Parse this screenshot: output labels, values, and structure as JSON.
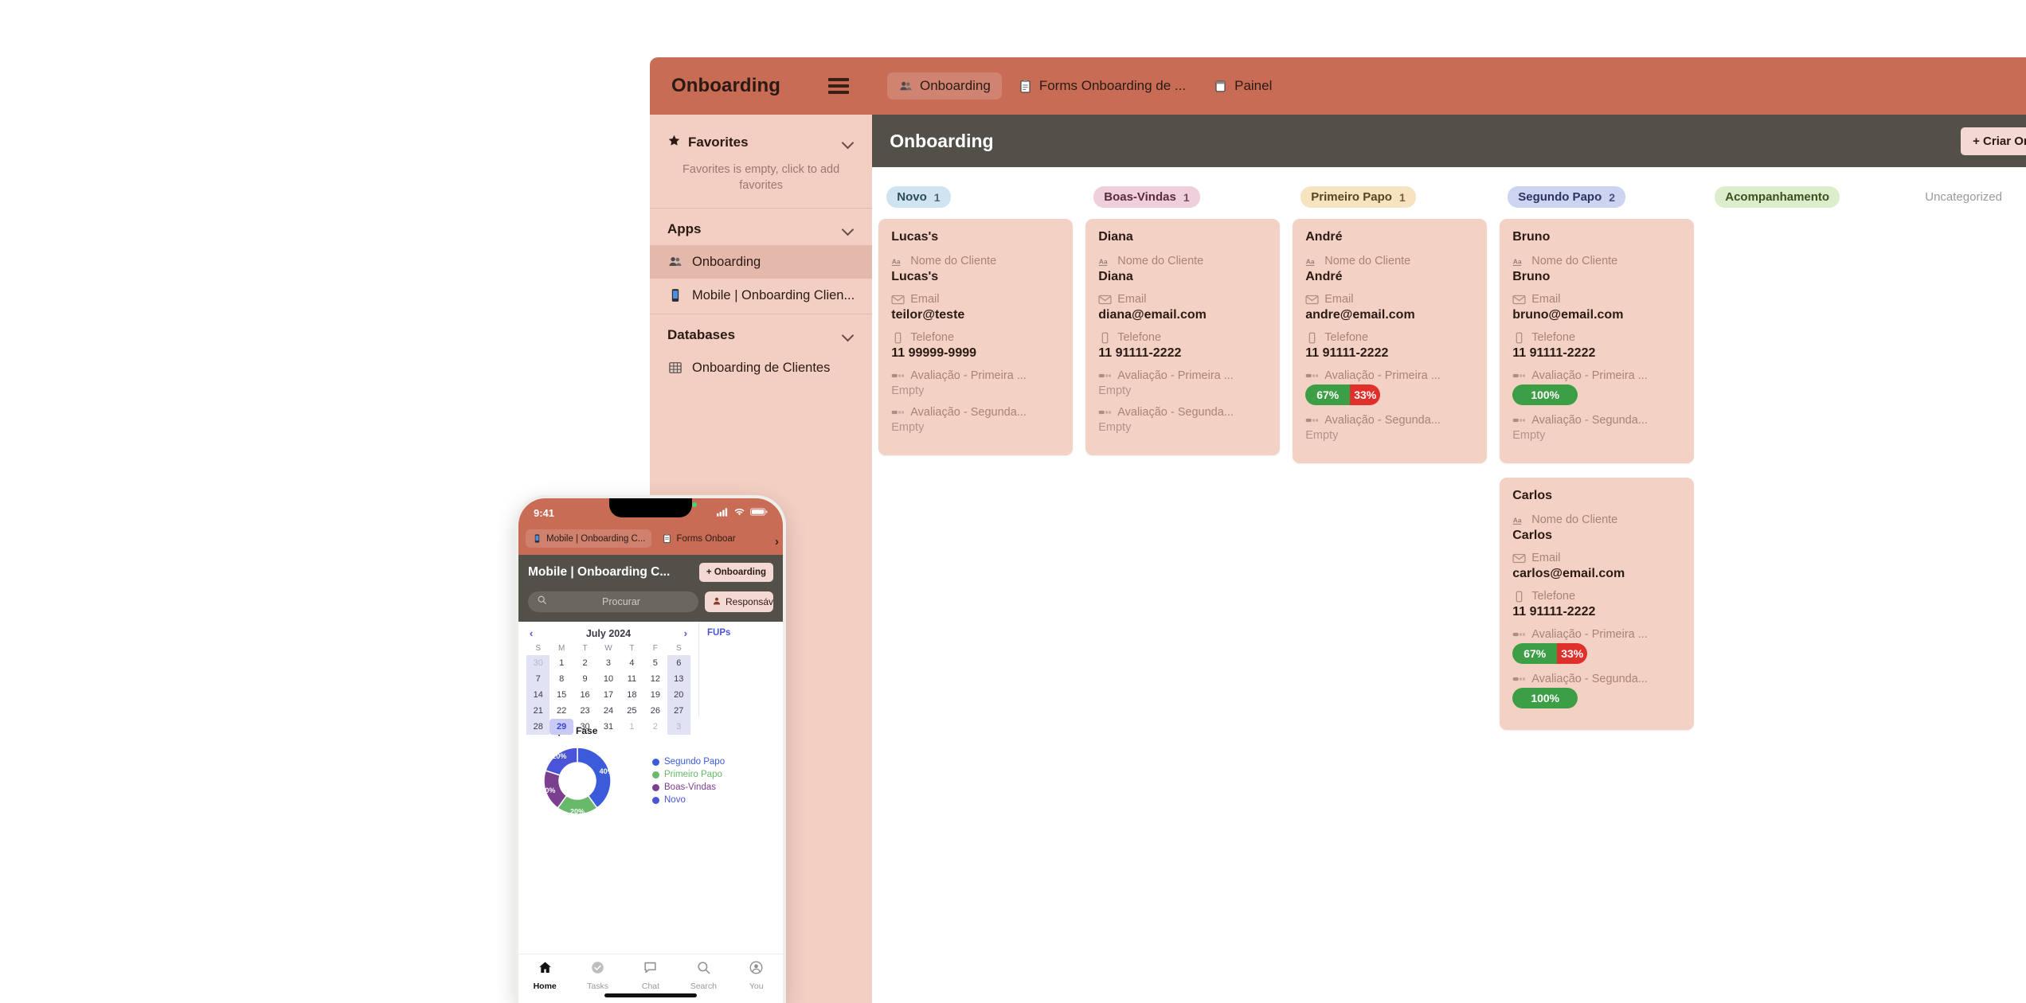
{
  "desktop": {
    "brand": {
      "title": "Onboarding",
      "menu_icon": "hamburger-icon"
    },
    "tabs": [
      {
        "label": "Onboarding",
        "icon": "people-icon",
        "active": true
      },
      {
        "label": "Forms Onboarding de ...",
        "icon": "clipboard-icon",
        "active": false
      },
      {
        "label": "Painel",
        "icon": "dashboard-icon",
        "active": false
      }
    ],
    "sidebar": {
      "favorites": {
        "label": "Favorites",
        "icon": "star-icon",
        "empty_text": "Favorites is empty, click to add favorites"
      },
      "apps": {
        "label": "Apps",
        "items": [
          {
            "label": "Onboarding",
            "icon": "people-icon",
            "active": true
          },
          {
            "label": "Mobile | Onboarding Clien...",
            "icon": "mobile-icon",
            "active": false
          }
        ]
      },
      "databases": {
        "label": "Databases",
        "items": [
          {
            "label": "Onboarding de Clientes",
            "icon": "table-icon",
            "active": false
          }
        ]
      }
    },
    "page": {
      "title": "Onboarding",
      "create_button": "+ Criar Onboarding"
    },
    "board": {
      "columns": [
        {
          "name": "Novo",
          "count": "1",
          "bg": "#cfe4f0",
          "fg": "#2b4a5a",
          "has_pill": true
        },
        {
          "name": "Boas-Vindas",
          "count": "1",
          "bg": "#f0cfdc",
          "fg": "#5a2b40",
          "has_pill": true
        },
        {
          "name": "Primeiro Papo",
          "count": "1",
          "bg": "#f6e3c0",
          "fg": "#5a4420",
          "has_pill": true
        },
        {
          "name": "Segundo Papo",
          "count": "2",
          "bg": "#ccd4f2",
          "fg": "#2b3560",
          "has_pill": true
        },
        {
          "name": "Acompanhamento",
          "count": "",
          "bg": "#dcedcb",
          "fg": "#3a5020",
          "has_pill": true
        },
        {
          "name": "Uncategorized",
          "count": "",
          "bg": "",
          "fg": "#9a9a9a",
          "has_pill": false
        }
      ],
      "field_labels": {
        "nome": "Nome do Cliente",
        "email": "Email",
        "telefone": "Telefone",
        "aval1": "Avaliação - Primeira ...",
        "aval2": "Avaliação - Segunda...",
        "empty": "Empty"
      },
      "cards": [
        {
          "col": 0,
          "title": "Lucas's",
          "nome": "Lucas's",
          "email": "teilor@teste",
          "telefone": "11 99999-9999",
          "aval1": {
            "type": "empty",
            "text": "Empty"
          },
          "aval2": {
            "type": "empty",
            "text": "Empty"
          }
        },
        {
          "col": 1,
          "title": "Diana",
          "nome": "Diana",
          "email": "diana@email.com",
          "telefone": "11 91111-2222",
          "aval1": {
            "type": "empty",
            "text": "Empty"
          },
          "aval2": {
            "type": "empty",
            "text": "Empty"
          }
        },
        {
          "col": 2,
          "title": "André",
          "nome": "André",
          "email": "andre@email.com",
          "telefone": "11 91111-2222",
          "aval1": {
            "type": "split",
            "green": "67%",
            "red": "33%"
          },
          "aval2": {
            "type": "empty",
            "text": "Empty"
          }
        },
        {
          "col": 3,
          "title": "Bruno",
          "nome": "Bruno",
          "email": "bruno@email.com",
          "telefone": "11 91111-2222",
          "aval1": {
            "type": "full",
            "green": "100%"
          },
          "aval2": {
            "type": "empty",
            "text": "Empty"
          }
        },
        {
          "col": 3,
          "title": "Carlos",
          "nome": "Carlos",
          "email": "carlos@email.com",
          "telefone": "11 91111-2222",
          "aval1": {
            "type": "split",
            "green": "67%",
            "red": "33%"
          },
          "aval2": {
            "type": "full",
            "green": "100%"
          }
        }
      ]
    }
  },
  "phone": {
    "status": {
      "time": "9:41",
      "signal_icon": "cellular-icon",
      "wifi_icon": "wifi-icon",
      "battery_icon": "battery-icon"
    },
    "tabs": [
      {
        "label": "Mobile | Onboarding C...",
        "icon": "mobile-icon",
        "active": true
      },
      {
        "label": "Forms Onboar",
        "icon": "clipboard-icon",
        "active": false
      }
    ],
    "tabs_more": "›",
    "header": {
      "title": "Mobile | Onboarding C...",
      "button": "+ Onboarding"
    },
    "search": {
      "placeholder": "Procurar",
      "icon": "search-icon"
    },
    "responsavel": {
      "label": "Responsáv",
      "icon": "person-icon"
    },
    "calendar": {
      "month": "July 2024",
      "prev": "‹",
      "next": "›",
      "dow": [
        "S",
        "M",
        "T",
        "W",
        "T",
        "F",
        "S"
      ],
      "weeks": [
        [
          {
            "d": "30",
            "mut": true,
            "we": true
          },
          {
            "d": "1"
          },
          {
            "d": "2"
          },
          {
            "d": "3"
          },
          {
            "d": "4"
          },
          {
            "d": "5"
          },
          {
            "d": "6",
            "we": true
          }
        ],
        [
          {
            "d": "7",
            "we": true
          },
          {
            "d": "8"
          },
          {
            "d": "9"
          },
          {
            "d": "10"
          },
          {
            "d": "11"
          },
          {
            "d": "12"
          },
          {
            "d": "13",
            "we": true
          }
        ],
        [
          {
            "d": "14",
            "we": true
          },
          {
            "d": "15"
          },
          {
            "d": "16"
          },
          {
            "d": "17"
          },
          {
            "d": "18"
          },
          {
            "d": "19"
          },
          {
            "d": "20",
            "we": true
          }
        ],
        [
          {
            "d": "21",
            "we": true
          },
          {
            "d": "22"
          },
          {
            "d": "23"
          },
          {
            "d": "24"
          },
          {
            "d": "25"
          },
          {
            "d": "26"
          },
          {
            "d": "27",
            "we": true
          }
        ],
        [
          {
            "d": "28",
            "we": true
          },
          {
            "d": "29",
            "sel": true
          },
          {
            "d": "30"
          },
          {
            "d": "31"
          },
          {
            "d": "1",
            "mut": true
          },
          {
            "d": "2",
            "mut": true
          },
          {
            "d": "3",
            "mut": true,
            "we": true
          }
        ]
      ]
    },
    "fups_label": "FUPs",
    "tabbar": [
      {
        "label": "Home",
        "icon": "home-icon",
        "active": true
      },
      {
        "label": "Tasks",
        "icon": "check-circle-icon",
        "active": false
      },
      {
        "label": "Chat",
        "icon": "chat-icon",
        "active": false
      },
      {
        "label": "Search",
        "icon": "search-icon",
        "active": false
      },
      {
        "label": "You",
        "icon": "person-circle-icon",
        "active": false
      }
    ]
  },
  "chart_data": {
    "type": "pie",
    "title": "Cards por Fase",
    "categories": [
      "Segundo Papo",
      "Primeiro Papo",
      "Boas-Vindas",
      "Novo"
    ],
    "values": [
      40,
      20,
      20,
      20
    ],
    "labels": [
      "40%",
      "20%",
      "20%",
      "20%"
    ],
    "colors": [
      "#3b5bdb",
      "#68b96a",
      "#7a3f8f",
      "#4a54d8"
    ],
    "legend_position": "right",
    "donut": true,
    "xlabel": "",
    "ylabel": ""
  }
}
